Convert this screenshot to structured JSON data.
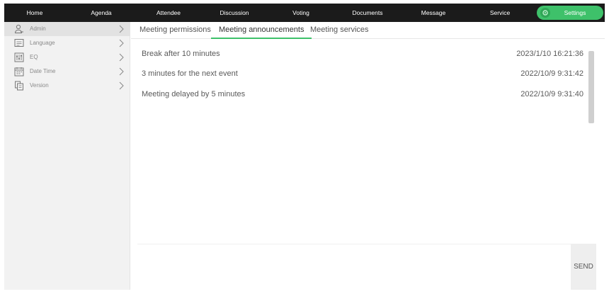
{
  "nav": {
    "items": [
      {
        "label": "Home"
      },
      {
        "label": "Agenda"
      },
      {
        "label": "Attendee"
      },
      {
        "label": "Discussion"
      },
      {
        "label": "Voting"
      },
      {
        "label": "Documents"
      },
      {
        "label": "Message"
      },
      {
        "label": "Service"
      }
    ],
    "settings_label": "Settings",
    "settings_icon": "gear-icon",
    "accent": "#3ec16a"
  },
  "sidebar": {
    "items": [
      {
        "label": "Admin",
        "icon": "admin-icon",
        "active": true
      },
      {
        "label": "Language",
        "icon": "language-icon"
      },
      {
        "label": "EQ",
        "icon": "eq-icon"
      },
      {
        "label": "Date Time",
        "icon": "calendar-icon"
      },
      {
        "label": "Version",
        "icon": "version-icon"
      }
    ]
  },
  "tabs": [
    {
      "label": "Meeting permissions"
    },
    {
      "label": "Meeting announcements",
      "active": true
    },
    {
      "label": "Meeting services"
    }
  ],
  "announcements": [
    {
      "text": "Break after 10 minutes",
      "time": "2023/1/10 16:21:36"
    },
    {
      "text": "3 minutes for the next event",
      "time": "2022/10/9 9:31:42"
    },
    {
      "text": "Meeting delayed by 5 minutes",
      "time": "2022/10/9 9:31:40"
    }
  ],
  "composer": {
    "value": "",
    "send_label": "SEND"
  }
}
